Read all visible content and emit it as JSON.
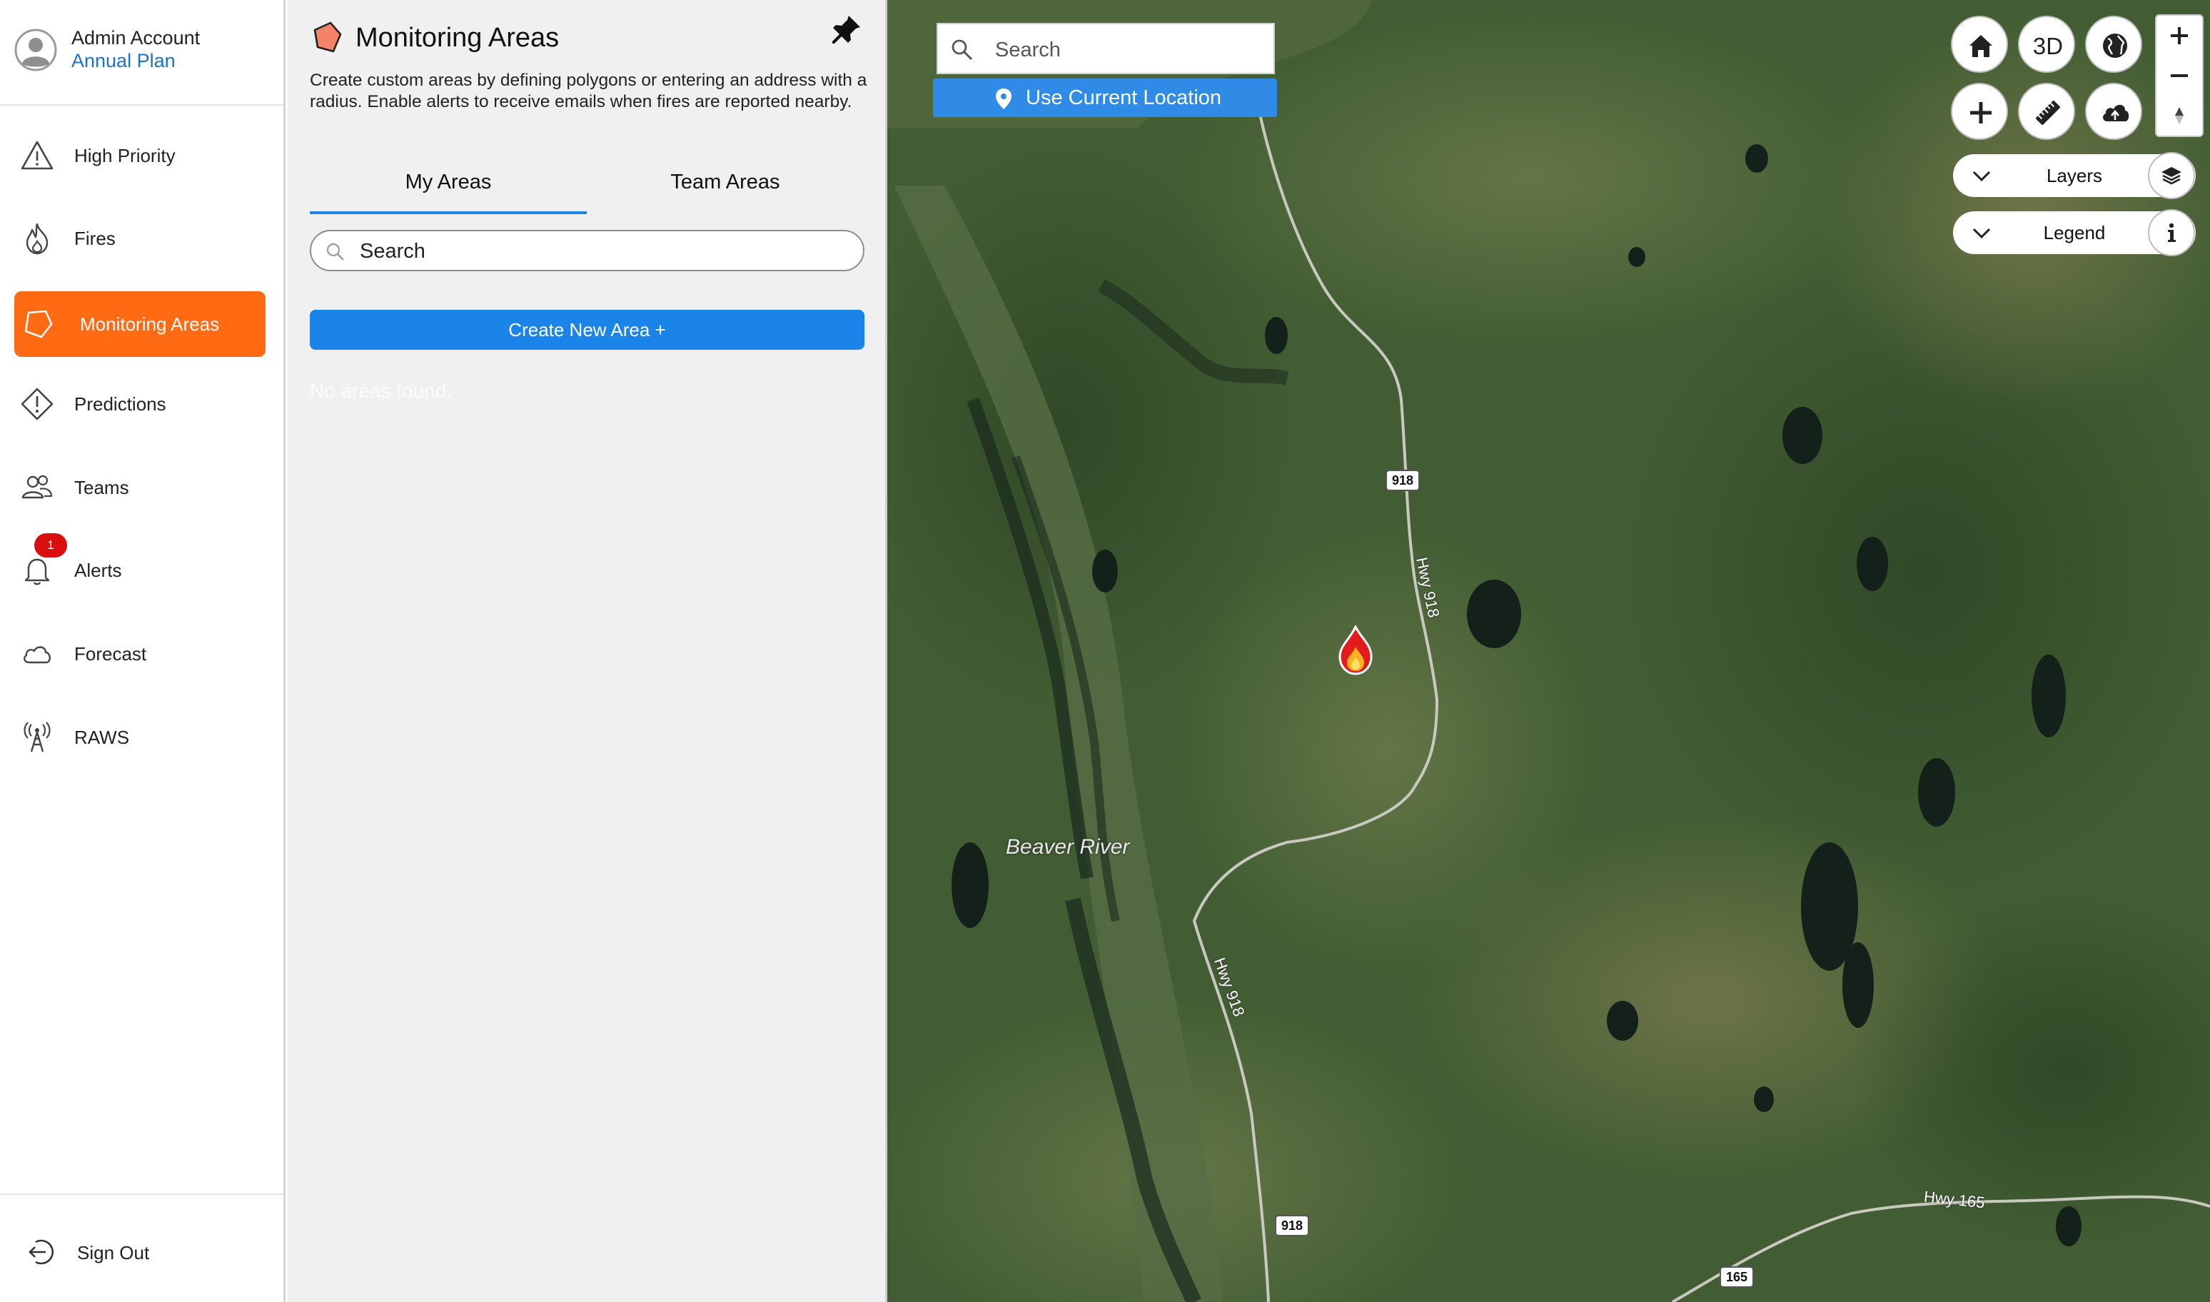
{
  "account": {
    "name": "Admin Account",
    "plan": "Annual Plan"
  },
  "nav": {
    "items": [
      {
        "label": "High Priority",
        "icon": "warning-icon"
      },
      {
        "label": "Fires",
        "icon": "fire-icon"
      },
      {
        "label": "Monitoring Areas",
        "icon": "polygon-icon",
        "active": true
      },
      {
        "label": "Predictions",
        "icon": "alert-diamond-icon"
      },
      {
        "label": "Teams",
        "icon": "team-icon"
      },
      {
        "label": "Alerts",
        "icon": "bell-icon",
        "badge": "1"
      },
      {
        "label": "Forecast",
        "icon": "cloud-icon"
      },
      {
        "label": "RAWS",
        "icon": "tower-icon"
      }
    ],
    "sign_out": "Sign Out"
  },
  "panel": {
    "title": "Monitoring Areas",
    "description": "Create custom areas by defining polygons or entering an address with a radius. Enable alerts to receive emails when fires are reported nearby.",
    "tabs": [
      {
        "label": "My Areas",
        "active": true
      },
      {
        "label": "Team Areas",
        "active": false
      }
    ],
    "search_placeholder": "Search",
    "create_button": "Create New Area +",
    "empty_text": "No areas found."
  },
  "map": {
    "search_placeholder": "Search",
    "use_location": "Use Current Location",
    "view_3d": "3D",
    "layers_label": "Layers",
    "legend_label": "Legend",
    "labels": {
      "river": "Beaver River",
      "hwy918_a": "Hwy 918",
      "hwy918_b": "Hwy 918",
      "hwy165": "Hwy 165",
      "shield918_a": "918",
      "shield918_b": "918",
      "shield165": "165"
    }
  },
  "colors": {
    "accent": "#ff6a13",
    "primary": "#1a84e8",
    "badge": "#d90f0f",
    "link": "#1a73c7"
  }
}
